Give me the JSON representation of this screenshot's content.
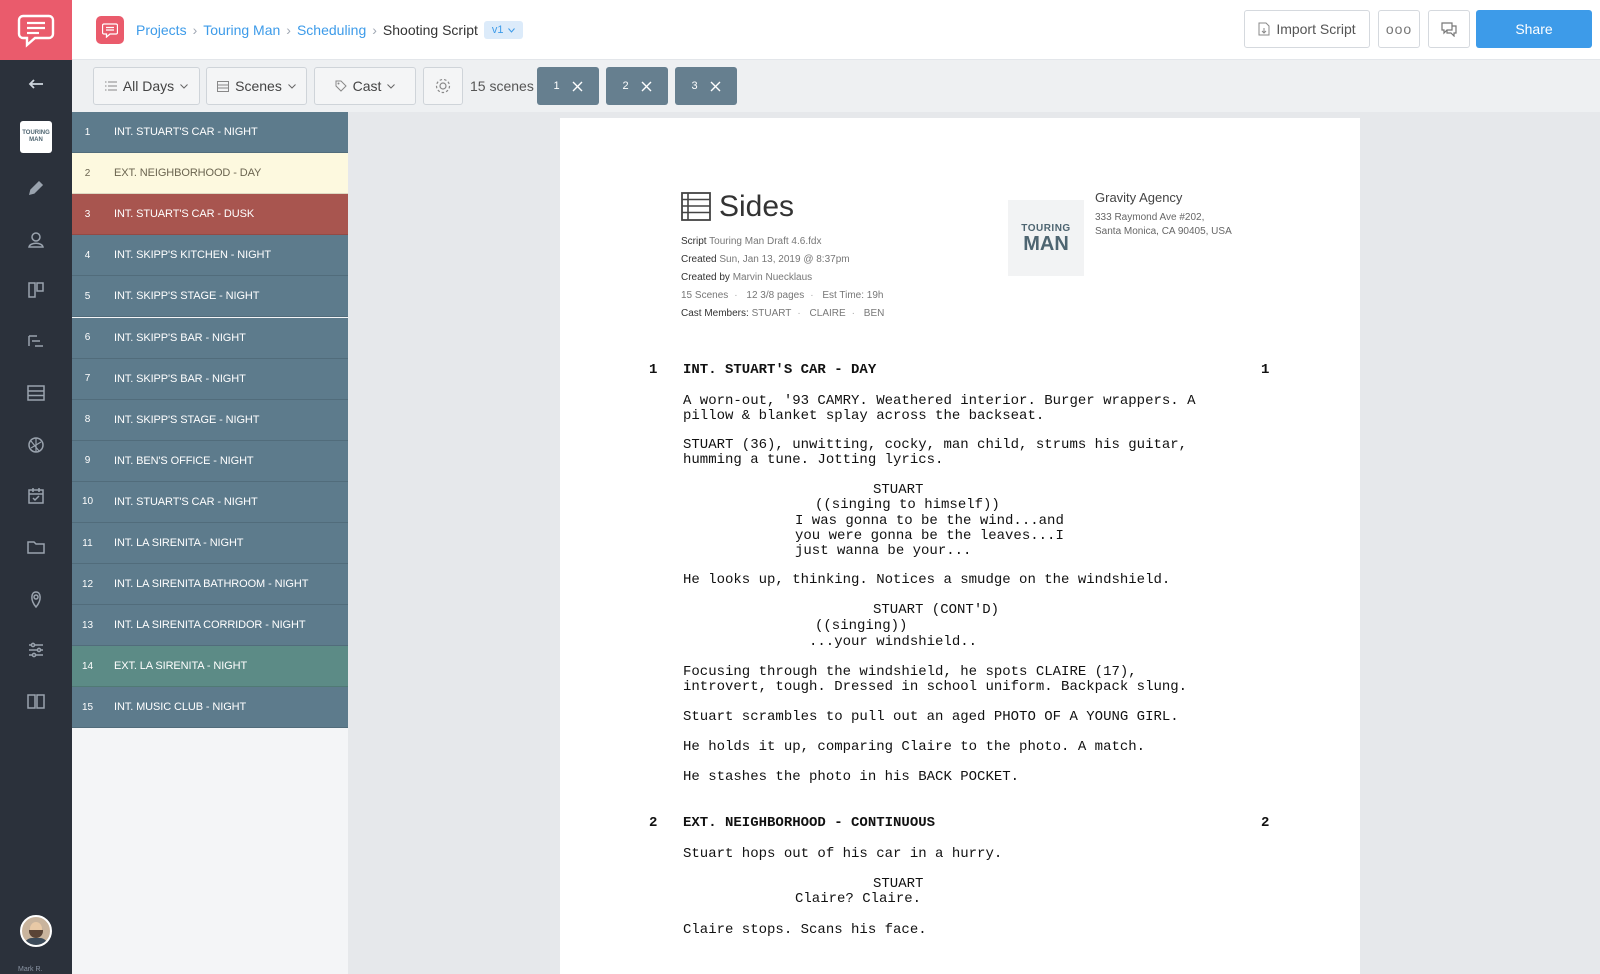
{
  "nav": {
    "items": [
      "back-arrow-icon",
      "project-thumbnail",
      "pencil-icon",
      "cast-icon",
      "board-icon",
      "schedule-icon",
      "stripboard-icon",
      "shot-icon",
      "calendar-icon",
      "folder-icon",
      "location-icon",
      "settings-sliders-icon",
      "book-icon"
    ],
    "thumbnail_text": [
      "TOURING",
      "MAN"
    ],
    "user_name": "Mark R."
  },
  "header": {
    "breadcrumb": [
      "Projects",
      "Touring Man",
      "Scheduling"
    ],
    "current": "Shooting Script",
    "version": "v1",
    "import_label": "Import Script",
    "more_label": "ooo",
    "share_label": "Share"
  },
  "toolbar": {
    "days_label": "All Days",
    "scenes_label": "Scenes",
    "cast_label": "Cast",
    "scene_count": "15 scenes",
    "chips": [
      "1",
      "2",
      "3"
    ]
  },
  "scenes": [
    {
      "num": "1",
      "name": "INT. STUART'S CAR - NIGHT",
      "color": "#5d7b8c"
    },
    {
      "num": "2",
      "name": "EXT. NEIGHBORHOOD - DAY",
      "color": "#fdf9df"
    },
    {
      "num": "3",
      "name": "INT. STUART'S CAR - DUSK",
      "color": "#a8554f"
    },
    {
      "num": "4",
      "name": "INT. SKIPP'S KITCHEN - NIGHT",
      "color": "#5d7b8c"
    },
    {
      "num": "5",
      "name": "INT. SKIPP'S STAGE - NIGHT",
      "color": "#5d7b8c"
    },
    {
      "num": "6",
      "name": "INT. SKIPP'S BAR - NIGHT",
      "color": "#5d7b8c"
    },
    {
      "num": "7",
      "name": "INT. SKIPP'S BAR - NIGHT",
      "color": "#5d7b8c"
    },
    {
      "num": "8",
      "name": "INT. SKIPP'S STAGE - NIGHT",
      "color": "#5d7b8c"
    },
    {
      "num": "9",
      "name": "INT. BEN'S OFFICE - NIGHT",
      "color": "#5d7b8c"
    },
    {
      "num": "10",
      "name": "INT. STUART'S CAR - NIGHT",
      "color": "#5d7b8c"
    },
    {
      "num": "11",
      "name": "INT. LA SIRENITA - NIGHT",
      "color": "#5d7b8c"
    },
    {
      "num": "12",
      "name": "INT. LA SIRENITA BATHROOM - NIGHT",
      "color": "#5d7b8c"
    },
    {
      "num": "13",
      "name": "INT. LA SIRENITA CORRIDOR - NIGHT",
      "color": "#5d7b8c"
    },
    {
      "num": "14",
      "name": "EXT. LA SIRENITA - NIGHT",
      "color": "#5c8b86"
    },
    {
      "num": "15",
      "name": "INT. MUSIC CLUB - NIGHT",
      "color": "#5d7b8c"
    }
  ],
  "sides": {
    "title": "Sides",
    "script_label": "Script",
    "script_value": "Touring Man Draft 4.6.fdx",
    "created_label": "Created",
    "created_value": "Sun, Jan 13, 2019 @ 8:37pm",
    "created_by_label": "Created by",
    "created_by_value": "Marvin Nuecklaus",
    "scenes": "15 Scenes",
    "pages": "12 3/8 pages",
    "est_time": "Est Time: 19h",
    "cast_label": "Cast Members:",
    "cast": [
      "STUART",
      "CLAIRE",
      "BEN"
    ],
    "logo_text": [
      "TOURING",
      "MAN"
    ],
    "agency_name": "Gravity Agency",
    "agency_addr1": "333 Raymond Ave #202,",
    "agency_addr2": "Santa Monica, CA 90405, USA"
  },
  "script": {
    "s1_num": "1",
    "s1_heading": "INT. STUART'S CAR - DAY",
    "s1_action1": "A worn-out, '93 CAMRY. Weathered interior. Burger wrappers. A\npillow & blanket splay across the backseat.",
    "s1_action2": "STUART (36), unwitting, cocky, man child, strums his guitar,\nhumming a tune. Jotting lyrics.",
    "s1_char1": "STUART",
    "s1_paren1": "((singing to himself))",
    "s1_dialog1": "I was gonna to be the wind...and\nyou were gonna be the leaves...I\njust wanna be your...",
    "s1_action3": "He looks up, thinking. Notices a smudge on the windshield.",
    "s1_char2": "STUART (CONT'D)",
    "s1_paren2": "((singing))",
    "s1_dialog2": "...your windshield..",
    "s1_action4": "Focusing through the windshield, he spots CLAIRE (17),\nintrovert, tough. Dressed in school uniform. Backpack slung.",
    "s1_action5": "Stuart scrambles to pull out an aged PHOTO OF A YOUNG GIRL.",
    "s1_action6": "He holds it up, comparing Claire to the photo. A match.",
    "s1_action7": "He stashes the photo in his BACK POCKET.",
    "s2_num": "2",
    "s2_heading": "EXT. NEIGHBORHOOD - CONTINUOUS",
    "s2_action1": "Stuart hops out of his car in a hurry.",
    "s2_char1": "STUART",
    "s2_dialog1": "Claire? Claire.",
    "s2_action2": "Claire stops. Scans his face."
  }
}
